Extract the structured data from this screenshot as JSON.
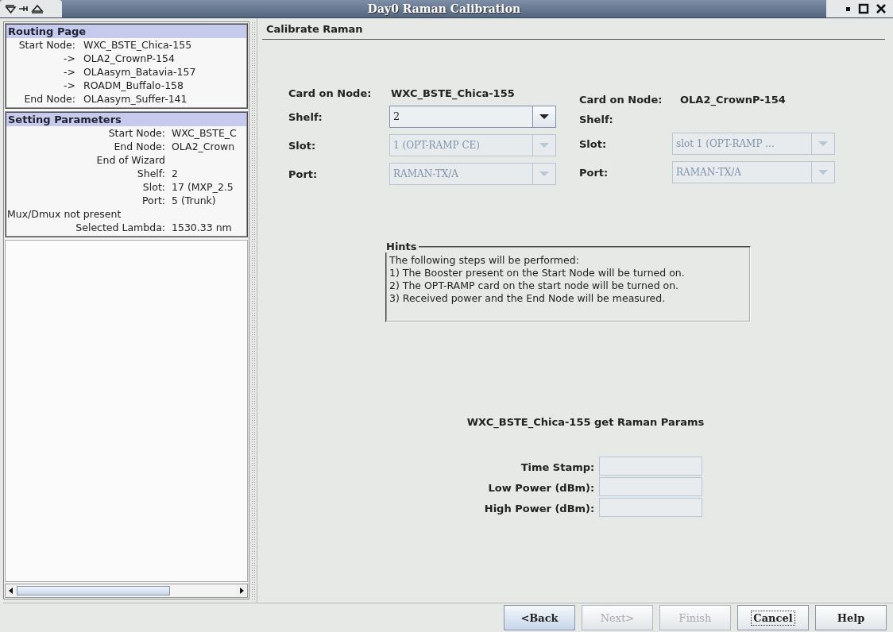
{
  "window": {
    "title": "Day0 Raman Calibration"
  },
  "routing": {
    "title": "Routing Page",
    "rows": [
      {
        "label": "Start Node:",
        "value": "WXC_BSTE_Chica-155"
      },
      {
        "label": "->",
        "value": "OLA2_CrownP-154"
      },
      {
        "label": "->",
        "value": "OLAasym_Batavia-157"
      },
      {
        "label": "->",
        "value": "ROADM_Buffalo-158"
      },
      {
        "label": "End Node:",
        "value": "OLAasym_Suffer-141"
      }
    ]
  },
  "parameters": {
    "title": "Setting Parameters",
    "rows": [
      {
        "kind": "pair",
        "label": "Start Node:",
        "value": "WXC_BSTE_C"
      },
      {
        "kind": "pair",
        "label": "End Node:",
        "value": "OLA2_Crown"
      },
      {
        "kind": "label",
        "label": "End of Wizard"
      },
      {
        "kind": "pair",
        "label": "Shelf:",
        "value": "2"
      },
      {
        "kind": "pair",
        "label": "Slot:",
        "value": "17 (MXP_2.5"
      },
      {
        "kind": "pair",
        "label": "Port:",
        "value": "5 (Trunk)"
      },
      {
        "kind": "full",
        "label": "Mux/Dmux not present"
      },
      {
        "kind": "pair",
        "label": "Selected Lambda:",
        "value": "1530.33 nm"
      }
    ]
  },
  "page_title": "Calibrate Raman",
  "cards": [
    {
      "heading": "Card on Node:",
      "node": "WXC_BSTE_Chica-155",
      "fields": [
        {
          "label": "Shelf:",
          "kind": "combo",
          "value": "2",
          "disabled": false
        },
        {
          "label": "Slot:",
          "kind": "combo",
          "value": "1 (OPT-RAMP CE)",
          "disabled": true
        },
        {
          "label": "Port:",
          "kind": "combo",
          "value": "RAMAN-TX/A",
          "disabled": true
        }
      ]
    },
    {
      "heading": "Card on Node:",
      "node": "OLA2_CrownP-154",
      "fields": [
        {
          "label": "Shelf:",
          "kind": "none"
        },
        {
          "label": "Slot:",
          "kind": "combo",
          "value": "slot  1 (OPT-RAMP ...",
          "disabled": true
        },
        {
          "label": "Port:",
          "kind": "combo",
          "value": "RAMAN-TX/A",
          "disabled": true
        }
      ]
    }
  ],
  "hints": {
    "title": "Hints",
    "lines": [
      "The following steps will be performed:",
      "1) The Booster present on the Start Node will be turned on.",
      "2) The OPT-RAMP card on the start node will be turned on.",
      "3) Received power and the End Node will be measured."
    ]
  },
  "status": "WXC_BSTE_Chica-155 get Raman Params",
  "results": [
    {
      "label": "Time Stamp:"
    },
    {
      "label": "Low Power (dBm):"
    },
    {
      "label": "High Power (dBm):"
    }
  ],
  "buttons": [
    {
      "label": "<Back",
      "disabled": false,
      "highlighted": true,
      "focused": false
    },
    {
      "label": "Next>",
      "disabled": true,
      "highlighted": false,
      "focused": false
    },
    {
      "label": "Finish",
      "disabled": true,
      "highlighted": false,
      "focused": false
    },
    {
      "label": "Cancel",
      "disabled": false,
      "highlighted": false,
      "focused": true
    },
    {
      "label": "Help",
      "disabled": false,
      "highlighted": false,
      "focused": false
    }
  ]
}
